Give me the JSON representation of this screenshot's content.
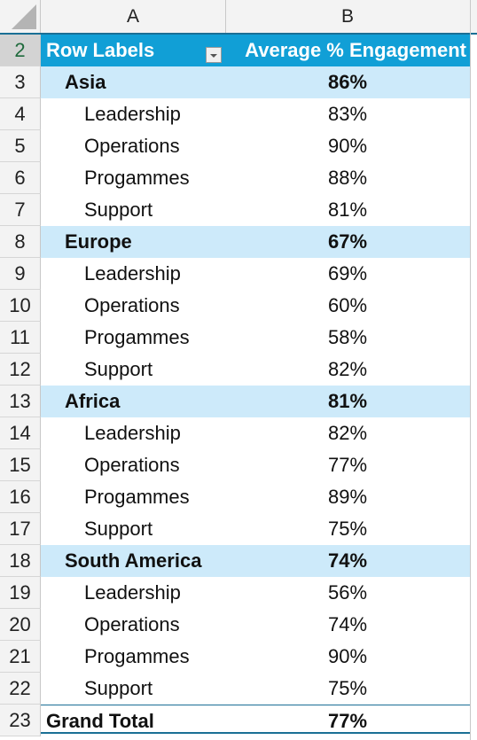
{
  "columns": [
    "A",
    "B"
  ],
  "header": {
    "row_num": "2",
    "label": "Row Labels",
    "value": "Average % Engagement"
  },
  "groups": [
    {
      "row_num": "3",
      "name": "Asia",
      "value": "86%",
      "items": [
        {
          "row_num": "4",
          "name": "Leadership",
          "value": "83%"
        },
        {
          "row_num": "5",
          "name": "Operations",
          "value": "90%"
        },
        {
          "row_num": "6",
          "name": "Progammes",
          "value": "88%"
        },
        {
          "row_num": "7",
          "name": "Support",
          "value": "81%"
        }
      ]
    },
    {
      "row_num": "8",
      "name": "Europe",
      "value": "67%",
      "items": [
        {
          "row_num": "9",
          "name": "Leadership",
          "value": "69%"
        },
        {
          "row_num": "10",
          "name": "Operations",
          "value": "60%"
        },
        {
          "row_num": "11",
          "name": "Progammes",
          "value": "58%"
        },
        {
          "row_num": "12",
          "name": "Support",
          "value": "82%"
        }
      ]
    },
    {
      "row_num": "13",
      "name": "Africa",
      "value": "81%",
      "items": [
        {
          "row_num": "14",
          "name": "Leadership",
          "value": "82%"
        },
        {
          "row_num": "15",
          "name": "Operations",
          "value": "77%"
        },
        {
          "row_num": "16",
          "name": "Progammes",
          "value": "89%"
        },
        {
          "row_num": "17",
          "name": "Support",
          "value": "75%"
        }
      ]
    },
    {
      "row_num": "18",
      "name": "South America",
      "value": "74%",
      "items": [
        {
          "row_num": "19",
          "name": "Leadership",
          "value": "56%"
        },
        {
          "row_num": "20",
          "name": "Operations",
          "value": "74%"
        },
        {
          "row_num": "21",
          "name": "Progammes",
          "value": "90%"
        },
        {
          "row_num": "22",
          "name": "Support",
          "value": "75%"
        }
      ]
    }
  ],
  "total": {
    "row_num": "23",
    "label": "Grand Total",
    "value": "77%"
  },
  "colors": {
    "header_bg": "#119fd6",
    "group_bg": "#cdeafa",
    "border_accent": "#1a6f95"
  }
}
